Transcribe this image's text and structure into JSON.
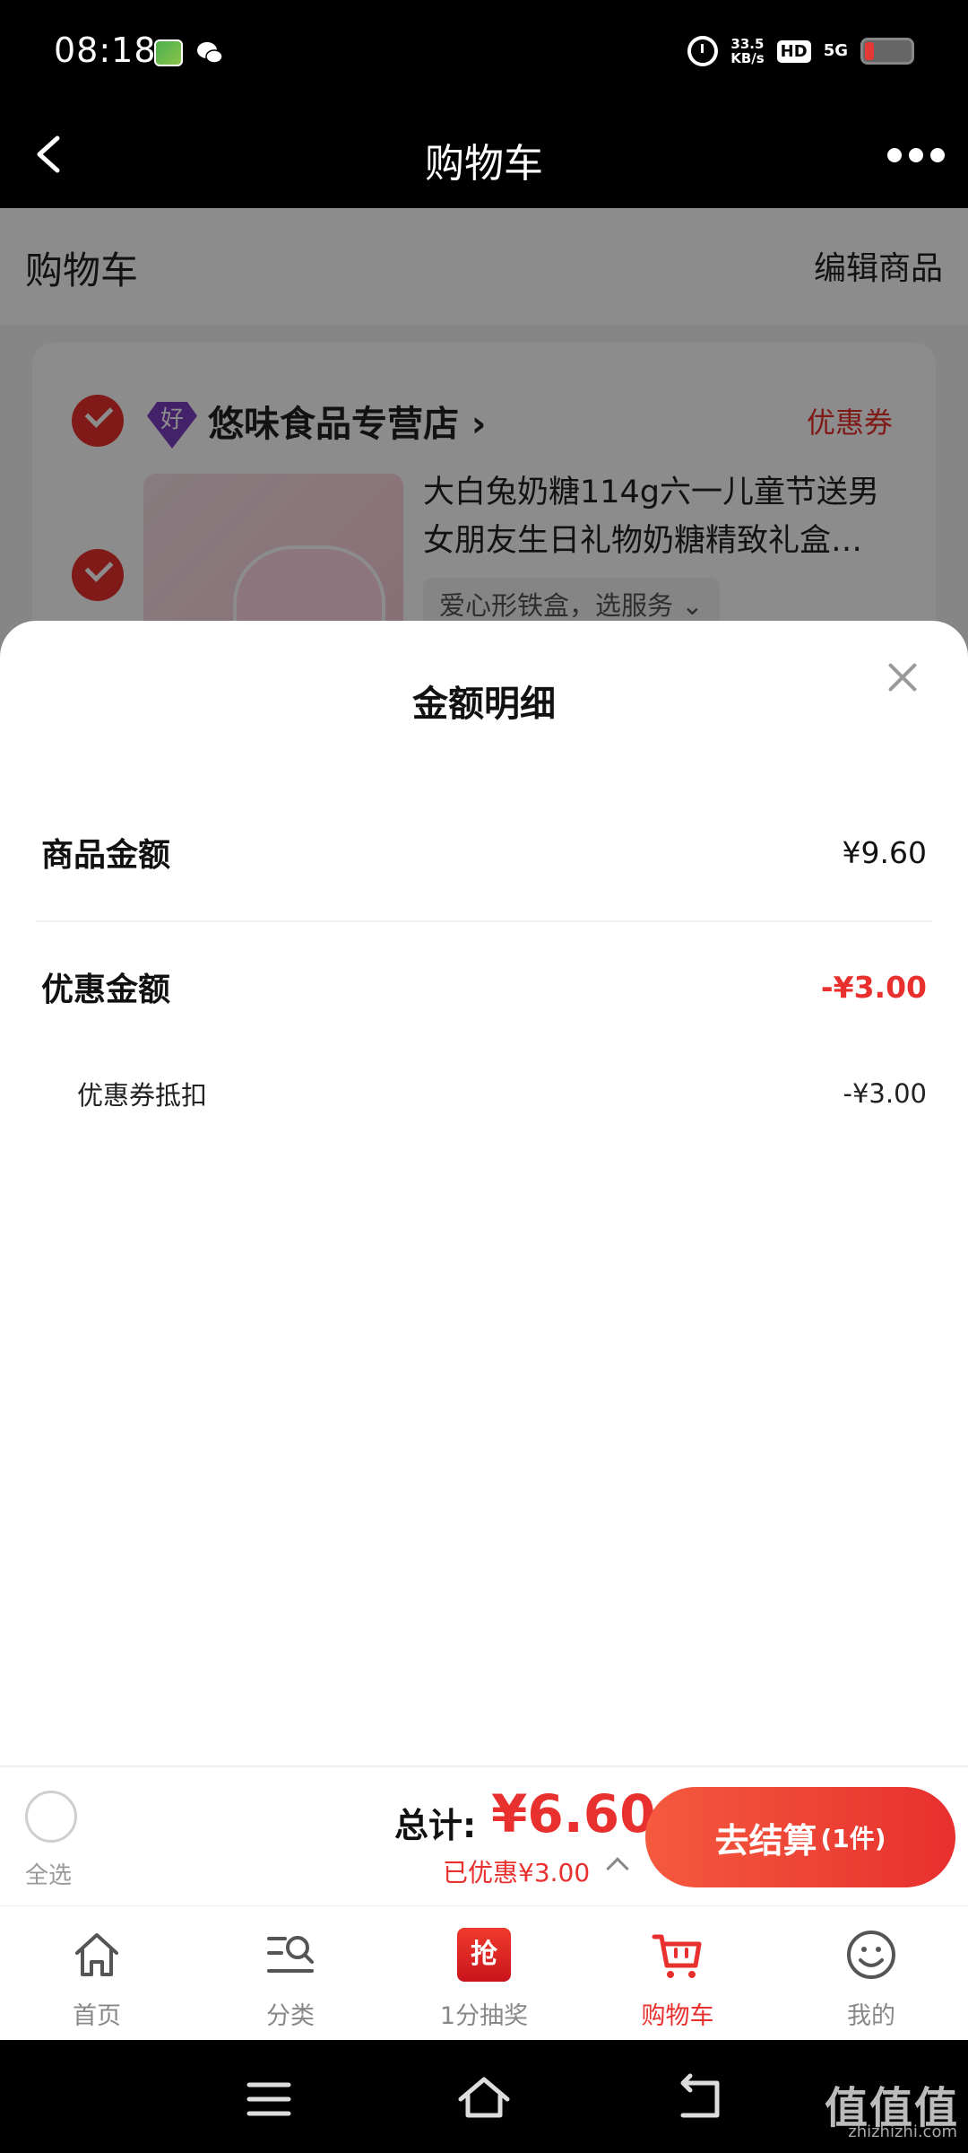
{
  "status_bar": {
    "time": "08:18",
    "speed_top": "33.5",
    "speed_bottom": "KB/s",
    "hd": "HD",
    "network": "5G"
  },
  "header": {
    "title": "购物车"
  },
  "cart": {
    "subhead_title": "购物车",
    "edit_label": "编辑商品",
    "store": {
      "badge": "好",
      "name": "悠味食品专营店",
      "coupon_label": "优惠券",
      "product_title": "大白兔奶糖114g六一儿童节送男女朋友生日礼物奶糖精致礼盒…",
      "product_spec": "爱心形铁盒，选服务"
    }
  },
  "sheet": {
    "title": "金额明细",
    "goods_label": "商品金额",
    "goods_value": "¥9.60",
    "discount_label": "优惠金额",
    "discount_value": "-¥3.00",
    "coupon_label": "优惠券抵扣",
    "coupon_value": "-¥3.00"
  },
  "checkout": {
    "select_all": "全选",
    "total_label": "总计:",
    "total_amount": "¥6.60",
    "saved": "已优惠¥3.00",
    "button_label": "去结算",
    "button_count": "(1件)"
  },
  "bottom_nav": [
    {
      "label": "首页",
      "icon": "home-icon"
    },
    {
      "label": "分类",
      "icon": "category-search-icon"
    },
    {
      "label": "1分抽奖",
      "icon": "lottery-icon",
      "icon_text": "抢"
    },
    {
      "label": "购物车",
      "icon": "cart-icon",
      "active": true
    },
    {
      "label": "我的",
      "icon": "smiley-icon"
    }
  ],
  "watermark": {
    "main": "值值值",
    "sub": "zhizhizhi.com"
  },
  "colors": {
    "accent": "#e8302e",
    "purple_badge": "#7b3fbf"
  }
}
